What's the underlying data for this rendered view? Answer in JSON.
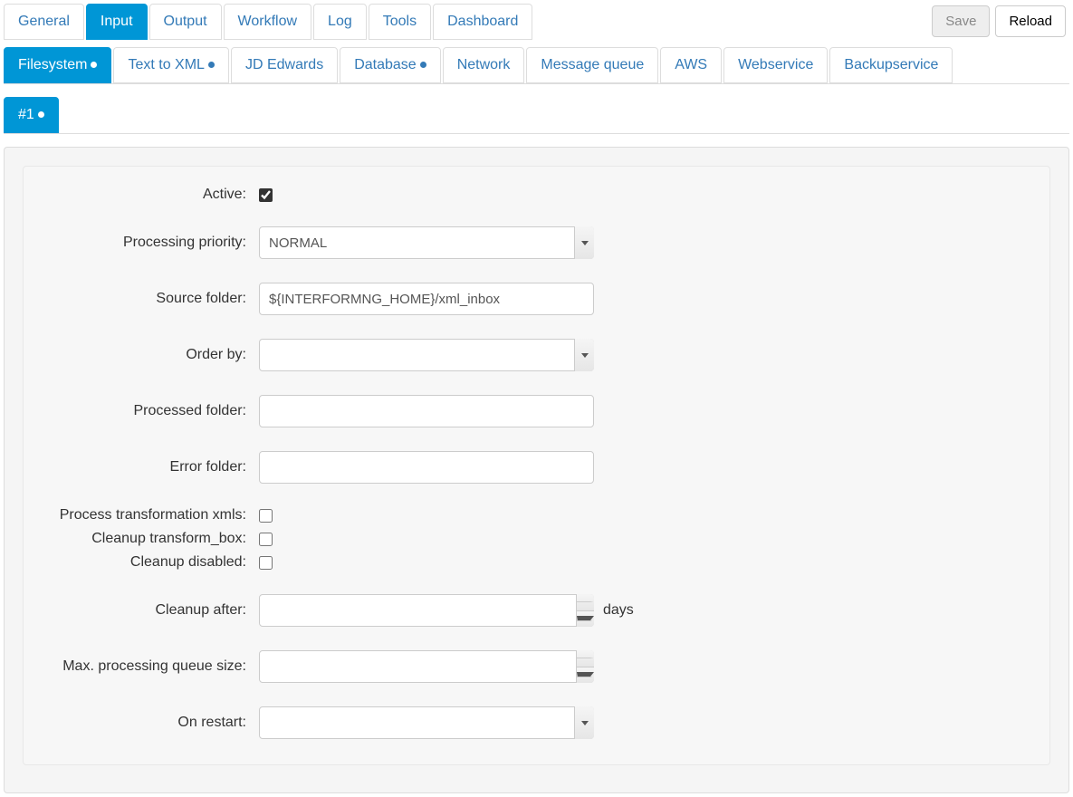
{
  "buttons": {
    "save": "Save",
    "reload": "Reload"
  },
  "mainTabs": [
    {
      "label": "General",
      "active": false
    },
    {
      "label": "Input",
      "active": true
    },
    {
      "label": "Output",
      "active": false
    },
    {
      "label": "Workflow",
      "active": false
    },
    {
      "label": "Log",
      "active": false
    },
    {
      "label": "Tools",
      "active": false
    },
    {
      "label": "Dashboard",
      "active": false
    }
  ],
  "subTabs": [
    {
      "label": "Filesystem",
      "active": true,
      "dot": true
    },
    {
      "label": "Text to XML",
      "active": false,
      "dot": true
    },
    {
      "label": "JD Edwards",
      "active": false,
      "dot": false
    },
    {
      "label": "Database",
      "active": false,
      "dot": true
    },
    {
      "label": "Network",
      "active": false,
      "dot": false
    },
    {
      "label": "Message queue",
      "active": false,
      "dot": false
    },
    {
      "label": "AWS",
      "active": false,
      "dot": false
    },
    {
      "label": "Webservice",
      "active": false,
      "dot": false
    },
    {
      "label": "Backupservice",
      "active": false,
      "dot": false
    }
  ],
  "instanceTabs": [
    {
      "label": "#1",
      "active": true,
      "dot": true
    }
  ],
  "form": {
    "active": {
      "label": "Active:",
      "checked": true
    },
    "priority": {
      "label": "Processing priority:",
      "value": "NORMAL",
      "options": [
        "NORMAL"
      ]
    },
    "sourceFolder": {
      "label": "Source folder:",
      "value": "${INTERFORMNG_HOME}/xml_inbox"
    },
    "orderBy": {
      "label": "Order by:",
      "value": ""
    },
    "processedFolder": {
      "label": "Processed folder:",
      "value": ""
    },
    "errorFolder": {
      "label": "Error folder:",
      "value": ""
    },
    "processTransformXmls": {
      "label": "Process transformation xmls:",
      "checked": false
    },
    "cleanupTransformBox": {
      "label": "Cleanup transform_box:",
      "checked": false
    },
    "cleanupDisabled": {
      "label": "Cleanup disabled:",
      "checked": false
    },
    "cleanupAfter": {
      "label": "Cleanup after:",
      "value": "",
      "suffix": "days"
    },
    "maxQueue": {
      "label": "Max. processing queue size:",
      "value": ""
    },
    "onRestart": {
      "label": "On restart:",
      "value": ""
    }
  }
}
